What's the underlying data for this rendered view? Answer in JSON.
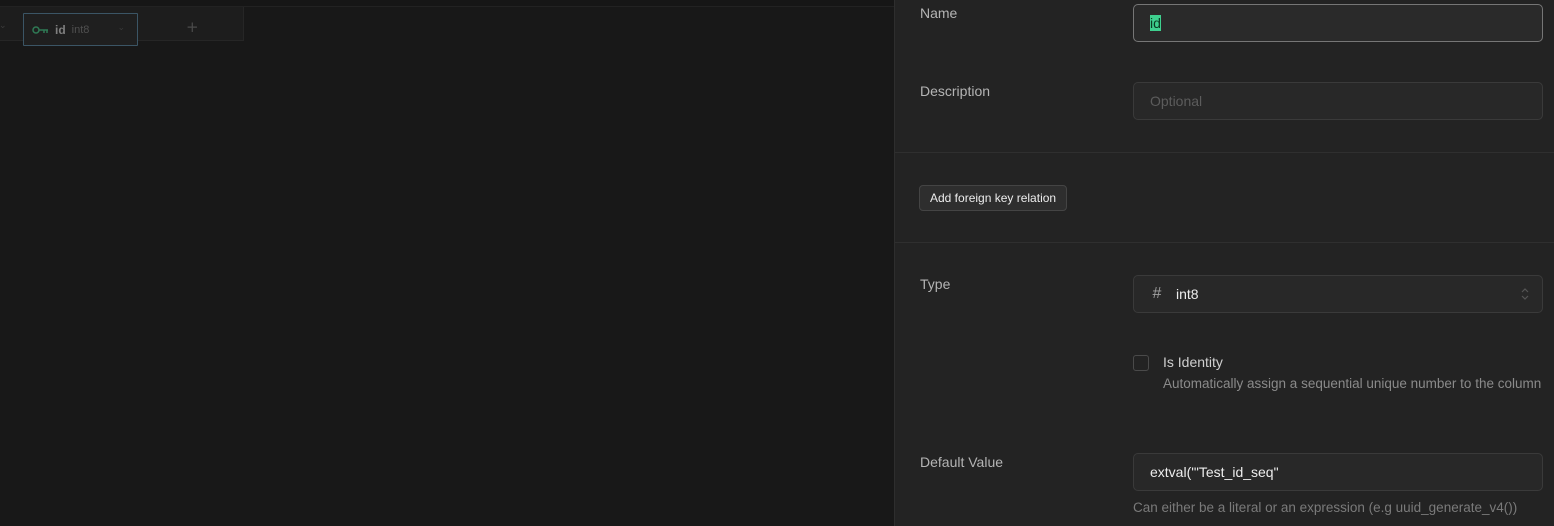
{
  "grid": {
    "column": {
      "name": "id",
      "type": "int8"
    },
    "icons": {
      "primary_key": "key-icon",
      "add_column": "plus-icon",
      "column_menu": "chevron-down-icon"
    }
  },
  "panel": {
    "name": {
      "label": "Name",
      "value": "id"
    },
    "description": {
      "label": "Description",
      "placeholder": "Optional"
    },
    "foreign_key_button": "Add foreign key relation",
    "type": {
      "label": "Type",
      "value": "int8",
      "icon": "hash-icon"
    },
    "identity": {
      "title": "Is Identity",
      "description": "Automatically assign a sequential unique number to the column",
      "checked": false
    },
    "default_value": {
      "label": "Default Value",
      "value": "extval('\"Test_id_seq\"",
      "help": "Can either be a literal or an expression (e.g uuid_generate_v4())"
    }
  },
  "colors": {
    "accent": "#3ecf8e",
    "panel_bg": "#232323",
    "grid_bg": "#181818"
  }
}
